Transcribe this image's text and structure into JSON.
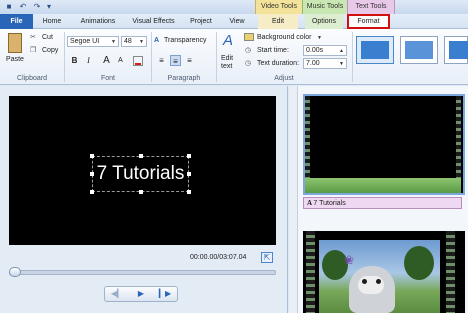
{
  "titlebar": {
    "quick_access": [
      "save-icon",
      "undo-icon",
      "redo-icon",
      "dropdown-icon"
    ],
    "contexts": {
      "video": "Video Tools",
      "music": "Music Tools",
      "text": "Text Tools"
    }
  },
  "tabs": {
    "file": "File",
    "home": "Home",
    "animations": "Animations",
    "visual_effects": "Visual Effects",
    "project": "Project",
    "view": "View",
    "edit": "Edit",
    "options": "Options",
    "format": "Format"
  },
  "ribbon": {
    "clipboard": {
      "paste": "Paste",
      "cut": "Cut",
      "copy": "Copy",
      "label": "Clipboard"
    },
    "font": {
      "family": "Segoe UI",
      "size": "48",
      "bold": "B",
      "italic": "I",
      "size_grow": "A",
      "size_shrink": "A",
      "label": "Font"
    },
    "paragraph": {
      "transparency": "Transparency",
      "label": "Paragraph"
    },
    "adjust": {
      "edit_text": "Edit",
      "edit_text_2": "text",
      "background_color": "Background color",
      "start_time_label": "Start time:",
      "start_time_value": "0.00s",
      "text_duration_label": "Text duration:",
      "text_duration_value": "7.00",
      "label": "Adjust"
    }
  },
  "preview": {
    "caption": "7 Tutorials",
    "timecode": "00:00.00/03:07.04"
  },
  "storyboard": {
    "caption_strip": "7 Tutorials"
  },
  "colors": {
    "accent": "#2a66b8",
    "highlight": "#d40f12",
    "text_tools": "#e8c9ea"
  }
}
